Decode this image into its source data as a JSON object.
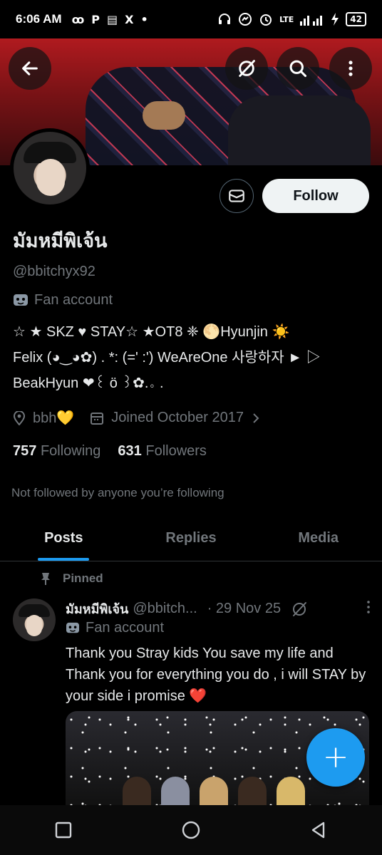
{
  "status_bar": {
    "time": "6:06 AM",
    "left_icons": [
      "ꝏ",
      "P",
      "▤",
      "X",
      "•"
    ],
    "right_icons": [
      "headset-icon",
      "messenger-icon",
      "alarm-icon"
    ],
    "network": "LTE",
    "battery": "42"
  },
  "profile": {
    "name": "มัมหมีพิเจ้น",
    "handle": "@bbitchyx92",
    "label": "Fan account",
    "bio_line1": "☆ ★ SKZ ♥ STAY☆ ★OT8 ❈ 🌕Hyunjin ☀️",
    "bio_line2": "Felix (◕‿◕✿) . *: (=' :') WeAreOne 사랑하자 ► ▷",
    "bio_line3": "BeakHyun ❤︎꒰ ö ꒱✿.。.",
    "location": "bbh💛",
    "joined": "Joined October 2017",
    "following_count": "757",
    "following_label": "Following",
    "followers_count": "631",
    "followers_label": "Followers",
    "not_followed": "Not followed by anyone you’re following",
    "follow_button": "Follow"
  },
  "tabs": [
    {
      "label": "Posts",
      "active": true
    },
    {
      "label": "Replies",
      "active": false
    },
    {
      "label": "Media",
      "active": false
    }
  ],
  "tweet": {
    "pinned_label": "Pinned",
    "name": "มัมหมีพิเจ้น",
    "handle": "@bbitch...",
    "date": "· 29 Nov 25",
    "label": "Fan account",
    "text": "Thank you Stray kids You save my life  and Thank you for everything you do , i will STAY by your side i promise ❤️"
  },
  "fab": {
    "symbol": "+"
  },
  "colors": {
    "accent": "#1d9bf0",
    "secondary_text": "#71767b",
    "primary_text": "#e7e9ea",
    "follow_bg": "#eff3f4"
  }
}
